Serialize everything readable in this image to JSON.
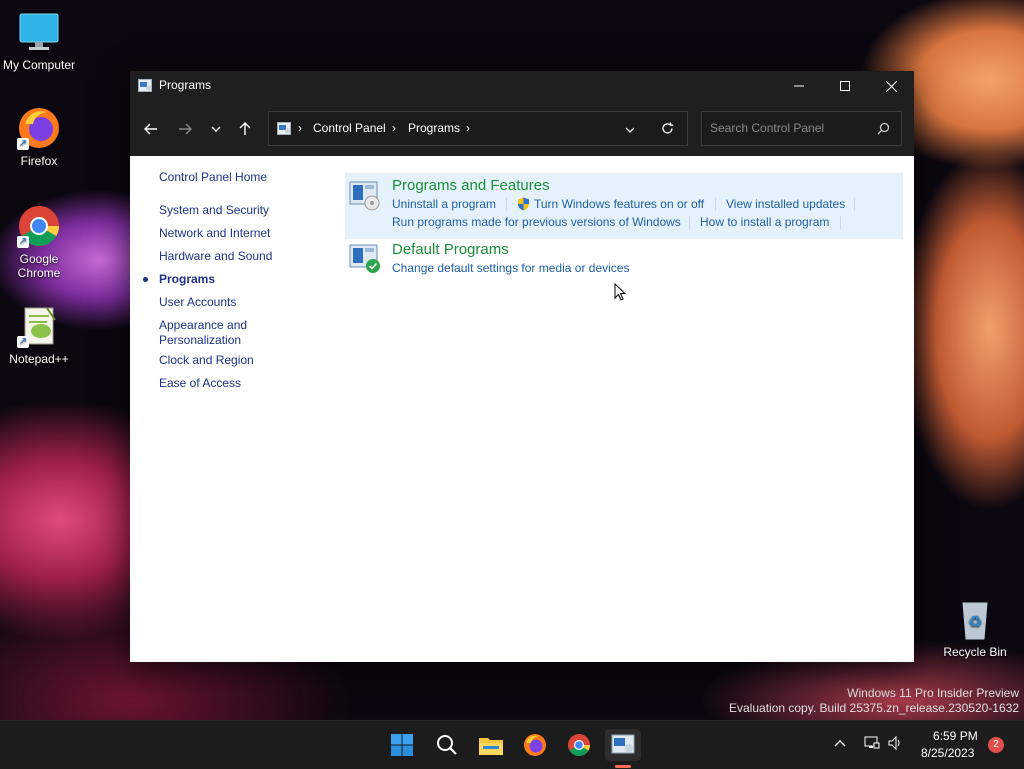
{
  "desktop": {
    "icons": [
      {
        "label": "My Computer"
      },
      {
        "label": "Firefox"
      },
      {
        "label": "Google Chrome"
      },
      {
        "label": "Notepad++"
      },
      {
        "label": "Recycle Bin"
      }
    ],
    "watermark_line1": "Windows 11 Pro Insider Preview",
    "watermark_line2": "Evaluation copy. Build 25375.zn_release.230520-1632"
  },
  "window": {
    "title": "Programs",
    "address": {
      "crumbs": [
        "Control Panel",
        "Programs"
      ]
    },
    "search_placeholder": "Search Control Panel",
    "sidebar": {
      "items": [
        {
          "label": "Control Panel Home"
        },
        {
          "label": "System and Security"
        },
        {
          "label": "Network and Internet"
        },
        {
          "label": "Hardware and Sound"
        },
        {
          "label": "Programs"
        },
        {
          "label": "User Accounts"
        },
        {
          "label": "Appearance and Personalization"
        },
        {
          "label": "Clock and Region"
        },
        {
          "label": "Ease of Access"
        }
      ],
      "active": "Programs"
    },
    "categories": [
      {
        "title": "Programs and Features",
        "links": [
          "Uninstall a program",
          "Turn Windows features on or off",
          "View installed updates",
          "Run programs made for previous versions of Windows",
          "How to install a program"
        ]
      },
      {
        "title": "Default Programs",
        "links": [
          "Change default settings for media or devices"
        ]
      }
    ]
  },
  "taskbar": {
    "time": "6:59 PM",
    "date": "8/25/2023",
    "notification_count": "2",
    "apps": [
      "start-icon",
      "search-icon",
      "file-explorer-icon",
      "firefox-icon",
      "chrome-icon",
      "control-panel-icon"
    ]
  },
  "colors": {
    "accent_green": "#1a8f3a",
    "link_blue": "#1f5fa8",
    "highlight": "#e6f2fb",
    "titlebar": "#1f1f1f"
  }
}
